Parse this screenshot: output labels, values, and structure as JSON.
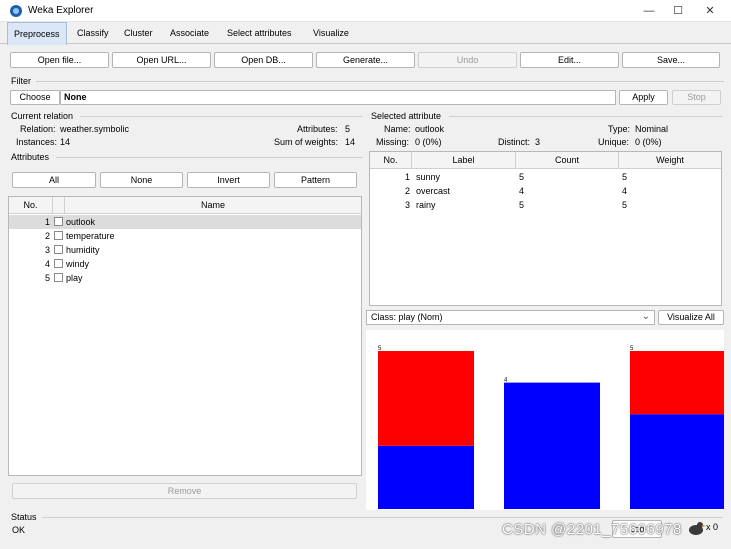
{
  "window": {
    "title": "Weka Explorer",
    "minimize": "—",
    "maximize": "☐",
    "close": "✕"
  },
  "tabs": [
    "Preprocess",
    "Classify",
    "Cluster",
    "Associate",
    "Select attributes",
    "Visualize"
  ],
  "toolbar": {
    "open_file": "Open file...",
    "open_url": "Open URL...",
    "open_db": "Open DB...",
    "generate": "Generate...",
    "undo": "Undo",
    "edit": "Edit...",
    "save": "Save..."
  },
  "filter": {
    "section": "Filter",
    "choose": "Choose",
    "value": "None",
    "apply": "Apply",
    "stop": "Stop"
  },
  "current_relation": {
    "section": "Current relation",
    "relation_label": "Relation:",
    "relation_value": "weather.symbolic",
    "instances_label": "Instances:",
    "instances_value": "14",
    "attributes_label": "Attributes:",
    "attributes_value": "5",
    "sow_label": "Sum of weights:",
    "sow_value": "14"
  },
  "attributes": {
    "section": "Attributes",
    "buttons": {
      "all": "All",
      "none": "None",
      "invert": "Invert",
      "pattern": "Pattern"
    },
    "col_no": "No.",
    "col_name": "Name",
    "rows": [
      {
        "no": "1",
        "name": "outlook"
      },
      {
        "no": "2",
        "name": "temperature"
      },
      {
        "no": "3",
        "name": "humidity"
      },
      {
        "no": "4",
        "name": "windy"
      },
      {
        "no": "5",
        "name": "play"
      }
    ],
    "remove": "Remove"
  },
  "selected_attribute": {
    "section": "Selected attribute",
    "name_label": "Name:",
    "name_value": "outlook",
    "type_label": "Type:",
    "type_value": "Nominal",
    "missing_label": "Missing:",
    "missing_value": "0 (0%)",
    "distinct_label": "Distinct:",
    "distinct_value": "3",
    "unique_label": "Unique:",
    "unique_value": "0 (0%)",
    "columns": [
      "No.",
      "Label",
      "Count",
      "Weight"
    ],
    "rows": [
      {
        "no": "1",
        "label": "sunny",
        "count": "5",
        "weight": "5"
      },
      {
        "no": "2",
        "label": "overcast",
        "count": "4",
        "weight": "4"
      },
      {
        "no": "3",
        "label": "rainy",
        "count": "5",
        "weight": "5"
      }
    ]
  },
  "class_select": {
    "value": "Class: play (Nom)",
    "visualize_all": "Visualize All"
  },
  "chart_data": {
    "type": "bar",
    "stacked": true,
    "categories": [
      "sunny",
      "overcast",
      "rainy"
    ],
    "series": [
      {
        "values": [
          3,
          0,
          2
        ],
        "color": "#ff0000"
      },
      {
        "values": [
          2,
          4,
          3
        ],
        "color": "#0000ff"
      }
    ],
    "totals_labels": [
      "5",
      "4",
      "5"
    ],
    "ylim": [
      0,
      5
    ]
  },
  "status": {
    "section": "Status",
    "text": "OK",
    "log": "Log",
    "x_count": "x 0"
  },
  "watermark": "CSDN @2201_75606978"
}
